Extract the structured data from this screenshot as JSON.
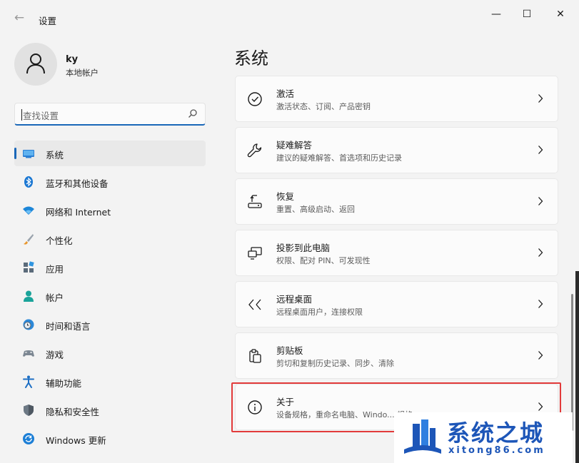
{
  "window": {
    "title": "设置",
    "back_glyph": "←",
    "minimize_glyph": "—",
    "maximize_glyph": "☐",
    "close_glyph": "✕"
  },
  "profile": {
    "name": "ky",
    "account_type": "本地帐户"
  },
  "search": {
    "placeholder": "查找设置"
  },
  "sidebar": {
    "items": [
      {
        "label": "系统",
        "icon": "system-monitor-icon",
        "active": true
      },
      {
        "label": "蓝牙和其他设备",
        "icon": "bluetooth-icon"
      },
      {
        "label": "网络和 Internet",
        "icon": "wifi-icon"
      },
      {
        "label": "个性化",
        "icon": "paintbrush-icon"
      },
      {
        "label": "应用",
        "icon": "apps-icon"
      },
      {
        "label": "帐户",
        "icon": "person-icon"
      },
      {
        "label": "时间和语言",
        "icon": "globe-clock-icon"
      },
      {
        "label": "游戏",
        "icon": "gamepad-icon"
      },
      {
        "label": "辅助功能",
        "icon": "accessibility-icon"
      },
      {
        "label": "隐私和安全性",
        "icon": "shield-icon"
      },
      {
        "label": "Windows 更新",
        "icon": "update-icon"
      }
    ]
  },
  "main": {
    "title": "系统",
    "cards": [
      {
        "title": "激活",
        "subtitle": "激活状态、订阅、产品密钥",
        "icon": "check-circle-icon"
      },
      {
        "title": "疑难解答",
        "subtitle": "建议的疑难解答、首选项和历史记录",
        "icon": "wrench-icon"
      },
      {
        "title": "恢复",
        "subtitle": "重置、高级启动、返回",
        "icon": "recovery-icon"
      },
      {
        "title": "投影到此电脑",
        "subtitle": "权限、配对 PIN、可发现性",
        "icon": "project-icon"
      },
      {
        "title": "远程桌面",
        "subtitle": "远程桌面用户，连接权限",
        "icon": "remote-desktop-icon"
      },
      {
        "title": "剪贴板",
        "subtitle": "剪切和复制历史记录、同步、清除",
        "icon": "clipboard-icon"
      },
      {
        "title": "关于",
        "subtitle": "设备规格，重命名电脑、Windo... 规格",
        "icon": "info-icon",
        "highlighted": true
      }
    ]
  },
  "watermark": {
    "text": "系统之城",
    "url": "xitong86.com"
  },
  "colors": {
    "accent": "#1a67b8",
    "highlight_border": "#e23a3a",
    "watermark_blue": "#1d56b8"
  }
}
